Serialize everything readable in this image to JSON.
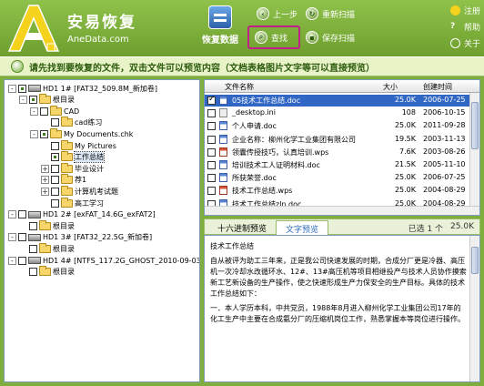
{
  "app": {
    "brand_cn": "安易恢复",
    "brand_en": "AneData.com",
    "recover_label": "恢复数据",
    "prev_label": "上一步",
    "rescan_label": "重新扫描",
    "search_label": "查找",
    "save_scan_label": "保存扫描",
    "register_label": "注册",
    "help_label": "帮助",
    "about_label": "关于"
  },
  "notice": "请先找到要恢复的文件，双击文件可以预览内容（文档表格图片文字等可以直接预览）",
  "tree": [
    {
      "label": "HD1  1# [FAT32_509.8M_新加卷]",
      "level": 0,
      "kind": "drive",
      "exp": "-",
      "chk": "part"
    },
    {
      "label": "根目录",
      "level": 1,
      "kind": "folder",
      "exp": "-",
      "chk": "part"
    },
    {
      "label": "CAD",
      "level": 2,
      "kind": "folder",
      "exp": "-",
      "chk": "off"
    },
    {
      "label": "cad练习",
      "level": 3,
      "kind": "folder",
      "exp": "",
      "chk": "off"
    },
    {
      "label": "My Documents.chk",
      "level": 2,
      "kind": "folder",
      "exp": "-",
      "chk": "part"
    },
    {
      "label": "My Pictures",
      "level": 3,
      "kind": "folder",
      "exp": "",
      "chk": "off"
    },
    {
      "label": "工作总结",
      "level": 3,
      "kind": "folder",
      "exp": "",
      "chk": "part",
      "selected": true
    },
    {
      "label": "毕业设计",
      "level": 3,
      "kind": "folder",
      "exp": "+",
      "chk": "off"
    },
    {
      "label": "荐1",
      "level": 3,
      "kind": "folder",
      "exp": "+",
      "chk": "off"
    },
    {
      "label": "计算机考试题",
      "level": 3,
      "kind": "folder",
      "exp": "+",
      "chk": "off"
    },
    {
      "label": "高工学习",
      "level": 3,
      "kind": "folder",
      "exp": "",
      "chk": "off"
    },
    {
      "label": "HD1  2# [exFAT_14.6G_exFAT2]",
      "level": 0,
      "kind": "drive",
      "exp": "-",
      "chk": "off"
    },
    {
      "label": "根目录",
      "level": 1,
      "kind": "folder",
      "exp": "",
      "chk": "off"
    },
    {
      "label": "HD1  3# [FAT32_22.5G_新加卷]",
      "level": 0,
      "kind": "drive",
      "exp": "-",
      "chk": "off"
    },
    {
      "label": "根目录",
      "level": 1,
      "kind": "folder",
      "exp": "",
      "chk": "off"
    },
    {
      "label": "HD1  4# [NTFS_117.2G_GHOST_2010-09-03]",
      "level": 0,
      "kind": "drive",
      "exp": "-",
      "chk": "off"
    },
    {
      "label": "根目录",
      "level": 1,
      "kind": "folder",
      "exp": "",
      "chk": "off"
    }
  ],
  "files": {
    "columns": [
      "文件名称",
      "大小",
      "创建时间"
    ],
    "rows": [
      {
        "name": "05技术工作总结.doc",
        "size": "25.0K",
        "date": "2006-07-25",
        "icon": "doc",
        "checked": true,
        "selected": true
      },
      {
        "name": "_desktop.ini",
        "size": "108",
        "date": "2006-10-15",
        "icon": "ini",
        "checked": false
      },
      {
        "name": "个人申请.doc",
        "size": "25.0K",
        "date": "2011-09-28",
        "icon": "doc",
        "checked": false
      },
      {
        "name": "企业名称：柳州化学工业集团有限公司",
        "size": "19.5K",
        "date": "2003-11-13",
        "icon": "doc",
        "checked": false
      },
      {
        "name": "领囊传授技巧，认真培训.wps",
        "size": "7.6K",
        "date": "2003-08-26",
        "icon": "wps",
        "checked": false
      },
      {
        "name": "培训技术工人证明材料.doc",
        "size": "21.5K",
        "date": "2005-11-10",
        "icon": "doc",
        "checked": false
      },
      {
        "name": "所获荣誉.doc",
        "size": "25.0K",
        "date": "2006-07-25",
        "icon": "doc",
        "checked": false
      },
      {
        "name": "技术工作总结.wps",
        "size": "25.0K",
        "date": "2004-08-29",
        "icon": "wps",
        "checked": false
      },
      {
        "name": "技术工作总结zln.doc",
        "size": "25.0K",
        "date": "2004-08-29",
        "icon": "doc",
        "checked": false
      }
    ]
  },
  "preview": {
    "tab_hex": "十六进制预览",
    "tab_text": "文字预览",
    "selected_label": "已选 1 个",
    "selected_size": "25.0K",
    "paragraphs": [
      "技术工作总结",
      "自从被评为助工三年来，正是我公司快速发展的时期，合成分厂更是冷器、高压机一次冷却水改循环水、12#、13#高压机等项目相继投产与技术人员协作摸索新工艺新设备的生产操作，使之快速形成生产力保安全的生产目标。具体的技术工作总结如下：",
      "一．本人学历本科，中共党员，1988年8月进入柳州化学工业集团公司17年的化工生产中主要在合成氨分厂的压缩机岗位工作，熟悉掌握本等岗位进行操作。"
    ]
  }
}
